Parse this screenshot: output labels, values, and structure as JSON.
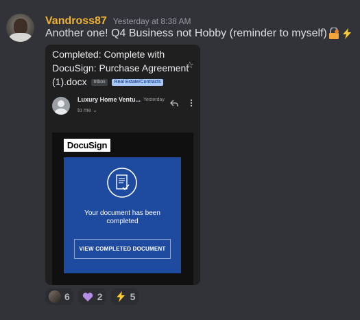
{
  "message": {
    "username": "Vandross87",
    "timestamp": "Yesterday at 8:38 AM",
    "content": "Another one! Q4 Business not Hobby (reminder to myself)",
    "content_emojis": [
      "lock-with-key-emoji",
      "lightning-emoji"
    ]
  },
  "email": {
    "subject_line1": "Completed: Complete with",
    "subject_line2": "DocuSign: Purchase Agreement",
    "subject_line3": "(1).docx",
    "labels": [
      "Inbox",
      "Real Estate/Contracts"
    ],
    "sender": "Luxury Home Ventu...",
    "time": "Yesterday",
    "to": "to me",
    "logo_text": "DocuSign",
    "panel_text_line1": "Your document has been",
    "panel_text_line2": "completed",
    "button_label": "VIEW COMPLETED DOCUMENT"
  },
  "reactions": [
    {
      "emoji": "user-avatar-emoji",
      "count": "6"
    },
    {
      "emoji": "purple-heart-emoji",
      "count": "2"
    },
    {
      "emoji": "lightning-emoji",
      "count": "5"
    }
  ],
  "colors": {
    "background": "#313338",
    "username": "#f0b232",
    "docusign_blue": "#1e4ba0",
    "label_chip": "#a8c7fa"
  }
}
